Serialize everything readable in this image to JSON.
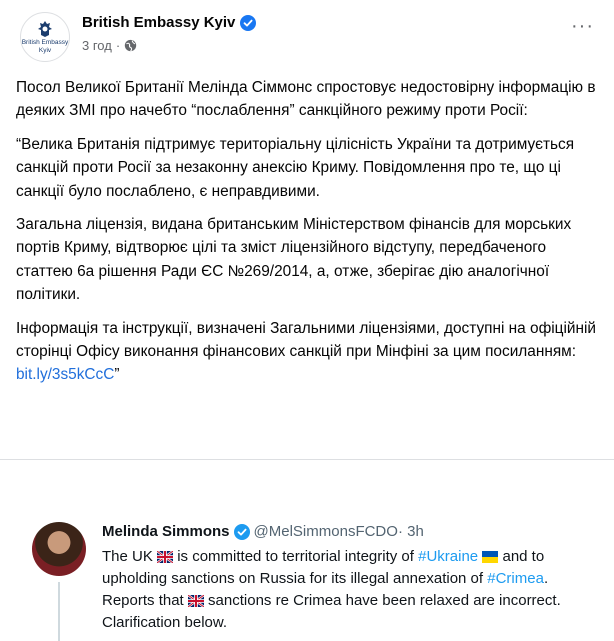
{
  "post": {
    "page_name": "British Embassy Kyiv",
    "avatar_text": [
      "British Embassy",
      "Kyiv"
    ],
    "time": "3 год",
    "separator": "·",
    "more": "···",
    "paragraphs": [
      "Посол Великої Британії Мелінда Сіммонс спростовує недостовірну інформацію в деяких ЗМІ про начебто “послаблення” санкційного режиму проти Росії:",
      "“Велика Британія підтримує територіальну цілісність України та дотримується санкцій проти Росії за незаконну анексію Криму. Повідомлення про те, що ці санкції було послаблено, є неправдивими.",
      "Загальна ліцензія, видана британським Міністерством фінансів для морських портів Криму, відтворює цілі та зміст ліцензійного відступу, передбаченого статтею 6а рішення Ради ЄС №269/2014, а, отже, зберігає дію аналогічної політики."
    ],
    "last_paragraph_text": "Інформація та інструкції, визначені Загальними ліцензіями, доступні на офіційній сторінці Офісу виконання фінансових санкцій при Мінфіні за цим посиланням: ",
    "link_text": "bit.ly/3s5kCcC",
    "closing_quote": "”"
  },
  "tweet": {
    "name": "Melinda Simmons",
    "handle": "@MelSimmonsFCDO",
    "time": "· 3h",
    "line1_a": "The UK ",
    "line1_b": " is committed to territorial integrity of ",
    "hashtag_ukraine": "#Ukraine",
    "line1_c": " and to upholding sanctions on Russia for its illegal annexation of ",
    "hashtag_crimea": "#Crimea",
    "line1_d": ". Reports that ",
    "line1_e": " sanctions re Crimea have been relaxed are incorrect. Clarification below."
  },
  "colors": {
    "link": "#216fdb",
    "hashtag": "#1d9bf0",
    "verified": "#1877f2",
    "twitter_verified": "#1d9bf0"
  }
}
